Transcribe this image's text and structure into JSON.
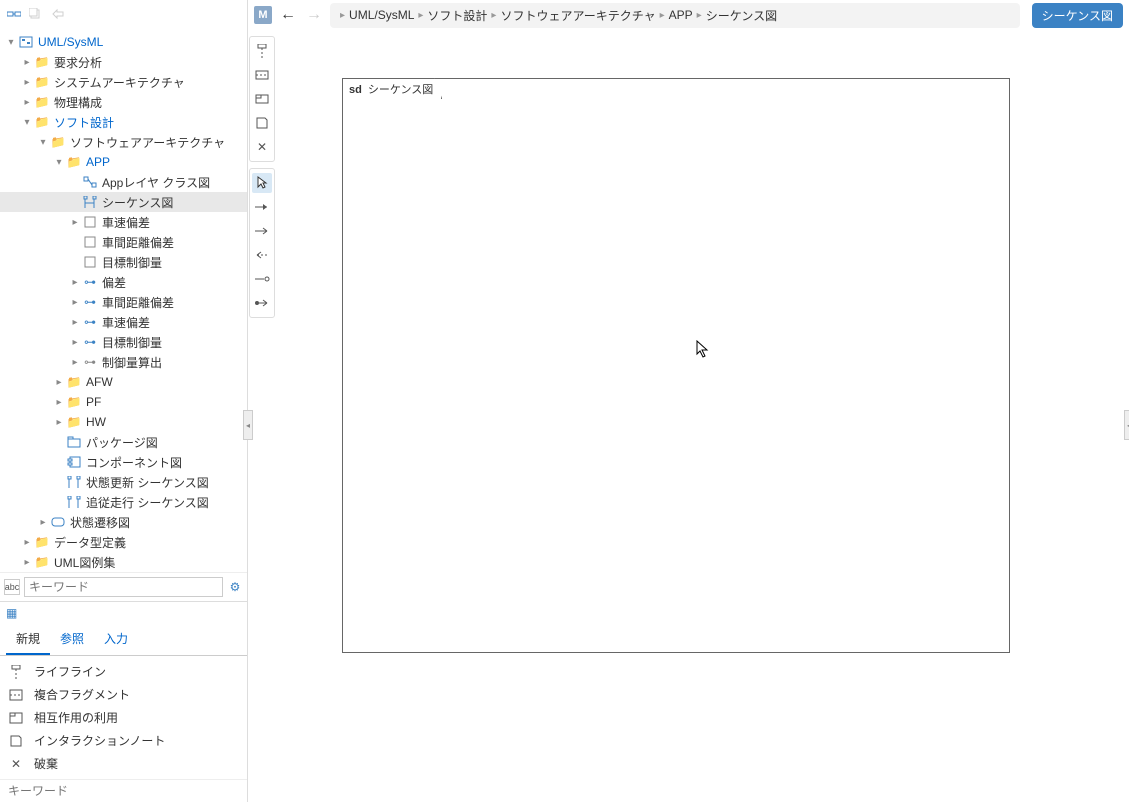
{
  "tree": {
    "root": "UML/SysML",
    "req": "要求分析",
    "sysarch": "システムアーキテクチャ",
    "phys": "物理構成",
    "soft": "ソフト設計",
    "swarch": "ソフトウェアアーキテクチャ",
    "app": "APP",
    "appclass": "Appレイヤ クラス図",
    "seq": "シーケンス図",
    "speed": "車速偏差",
    "dist": "車間距離偏差",
    "target": "目標制御量",
    "dev": "偏差",
    "distdev": "車間距離偏差",
    "speeddev": "車速偏差",
    "targetctrl": "目標制御量",
    "ctrlcalc": "制御量算出",
    "afw": "AFW",
    "pf": "PF",
    "hw": "HW",
    "pkg": "パッケージ図",
    "comp": "コンポーネント図",
    "stateupd": "状態更新 シーケンス図",
    "follow": "追従走行 シーケンス図",
    "statetrans": "状態遷移図",
    "datadef": "データ型定義",
    "examples": "UML図例集"
  },
  "search": {
    "placeholder": "キーワード"
  },
  "tabs": {
    "new": "新規",
    "ref": "参照",
    "input": "入力"
  },
  "palette": {
    "lifeline": "ライフライン",
    "combined": "複合フラグメント",
    "interuse": "相互作用の利用",
    "note": "インタラクションノート",
    "destroy": "破棄"
  },
  "keyword": {
    "placeholder": "キーワード"
  },
  "topbar": {
    "m": "M",
    "crumbs": [
      "UML/SysML",
      "ソフト設計",
      "ソフトウェアアーキテクチャ",
      "APP",
      "シーケンス図"
    ],
    "badge": "シーケンス図"
  },
  "canvas": {
    "sd": "sd",
    "title": "シーケンス図"
  }
}
